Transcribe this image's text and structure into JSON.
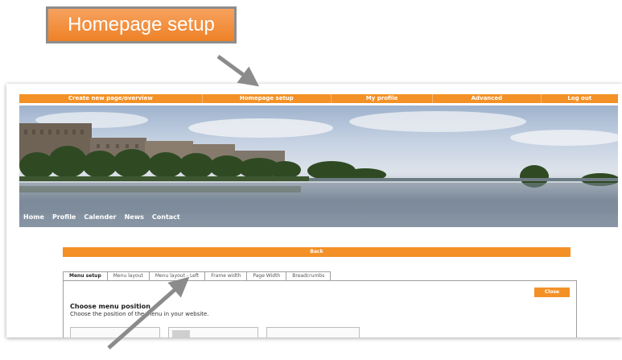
{
  "callout": {
    "label": "Homepage setup"
  },
  "topnav": {
    "items": [
      "Create new page/overview",
      "Homepage setup",
      "My profile",
      "Advanced",
      "Log out"
    ]
  },
  "mainnav": {
    "items": [
      "Home",
      "Profile",
      "Calender",
      "News",
      "Contact"
    ]
  },
  "back_label": "Back",
  "tabs": [
    "Menu setup",
    "Menu layout",
    "Menu layout - Left",
    "Frame width",
    "Page Width",
    "Breadcrumbs"
  ],
  "panel": {
    "close_label": "Close",
    "title": "Choose menu position",
    "description": "Choose the position of the menu in your website."
  },
  "colors": {
    "accent": "#f39126",
    "callout_top": "#f7a25e",
    "callout_bottom": "#ee8127",
    "arrow": "#8b8b8b"
  }
}
